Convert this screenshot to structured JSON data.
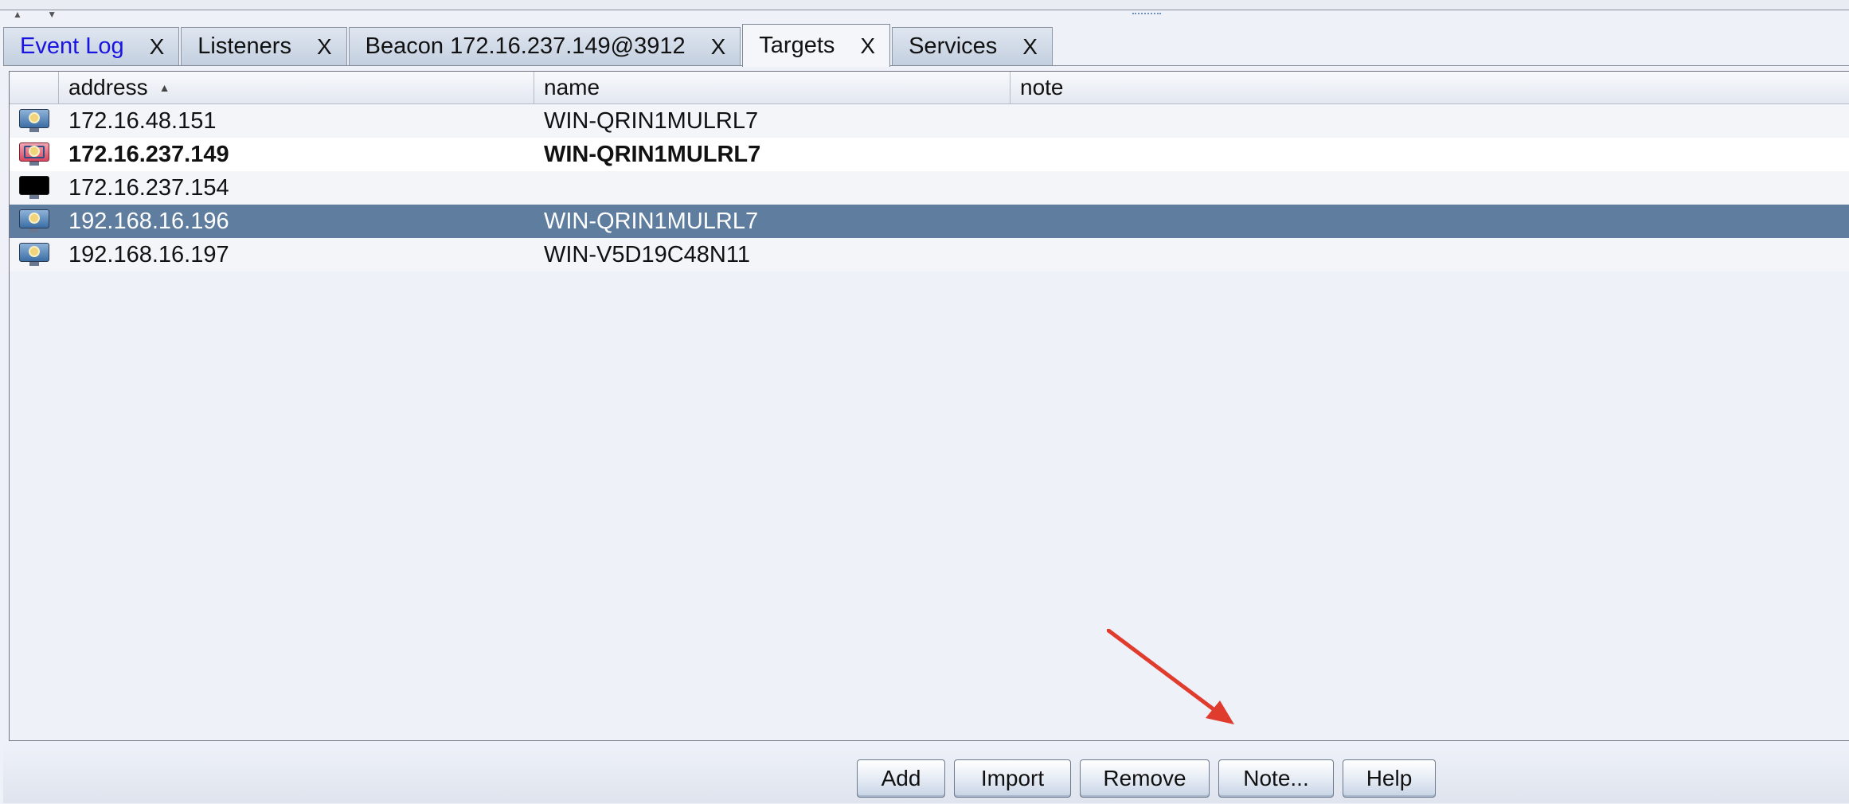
{
  "window": {
    "split_arrows": "▲ ▼"
  },
  "tabs": [
    {
      "label": "Event Log",
      "close": "X",
      "link": true
    },
    {
      "label": "Listeners",
      "close": "X"
    },
    {
      "label": "Beacon 172.16.237.149@3912",
      "close": "X"
    },
    {
      "label": "Targets",
      "close": "X",
      "active": true
    },
    {
      "label": "Services",
      "close": "X"
    }
  ],
  "table": {
    "columns": {
      "address": "address",
      "name": "name",
      "note": "note"
    },
    "sort_column": "address",
    "sort_direction": "ascending",
    "rows": [
      {
        "icon": "windows-host-icon",
        "address": "172.16.48.151",
        "name": "WIN-QRIN1MULRL7",
        "note": ""
      },
      {
        "icon": "windows-session-host-icon",
        "address": "172.16.237.149",
        "name": "WIN-QRIN1MULRL7",
        "note": "",
        "bold": true
      },
      {
        "icon": "unknown-host-icon",
        "address": "172.16.237.154",
        "name": "",
        "note": ""
      },
      {
        "icon": "windows-host-icon",
        "address": "192.168.16.196",
        "name": "WIN-QRIN1MULRL7",
        "note": "",
        "selected": true
      },
      {
        "icon": "windows-host-icon",
        "address": "192.168.16.197",
        "name": "WIN-V5D19C48N11",
        "note": ""
      }
    ]
  },
  "buttons": {
    "add": "Add",
    "import": "Import",
    "remove": "Remove",
    "note": "Note...",
    "help": "Help"
  },
  "colors": {
    "selection": "#5f7d9f",
    "link_tab": "#1a14e0",
    "annotation_arrow": "#e03c2e"
  }
}
